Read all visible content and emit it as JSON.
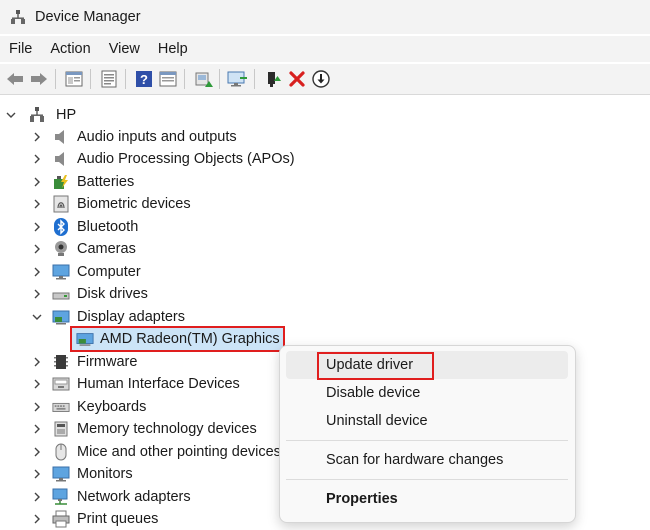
{
  "window": {
    "title": "Device Manager"
  },
  "menu": [
    "File",
    "Action",
    "View",
    "Help"
  ],
  "toolbar": {
    "buttons": [
      "back-icon",
      "forward-icon",
      "properties-icon",
      "console-tree-icon",
      "help-icon",
      "view-icon",
      "update-driver-icon",
      "scan-hardware-icon",
      "add-legacy-icon",
      "uninstall-icon",
      "disable-icon"
    ]
  },
  "tree": {
    "root": "HP",
    "categories": [
      "Audio inputs and outputs",
      "Audio Processing Objects (APOs)",
      "Batteries",
      "Biometric devices",
      "Bluetooth",
      "Cameras",
      "Computer",
      "Disk drives",
      "Display adapters",
      "Firmware",
      "Human Interface Devices",
      "Keyboards",
      "Memory technology devices",
      "Mice and other pointing devices",
      "Monitors",
      "Network adapters",
      "Print queues"
    ],
    "selected_child": "AMD Radeon(TM) Graphics"
  },
  "context_menu": {
    "items": [
      "Update driver",
      "Disable device",
      "Uninstall device",
      "Scan for hardware changes",
      "Properties"
    ]
  },
  "colors": {
    "highlight_border": "#e01e1e",
    "selection_bg": "#cce4f7"
  }
}
